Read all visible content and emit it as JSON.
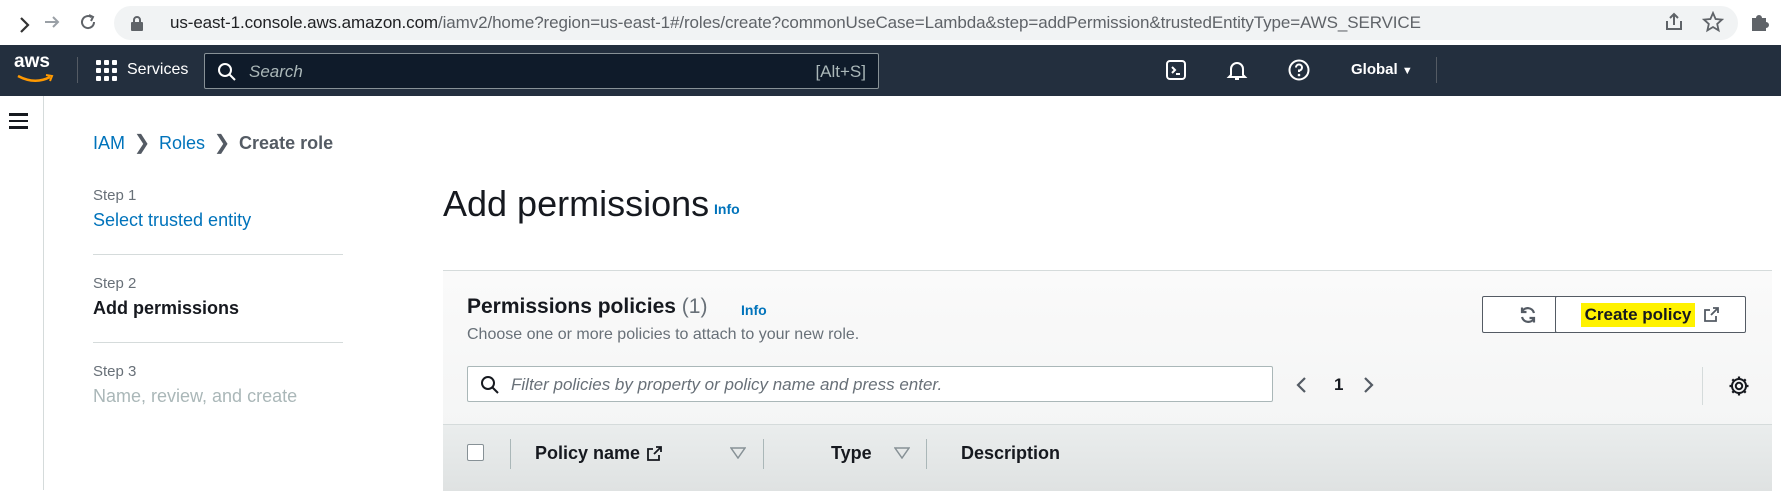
{
  "browser": {
    "url_host": "us-east-1.console.aws.amazon.com",
    "url_path": "/iamv2/home?region=us-east-1#/roles/create?commonUseCase=Lambda&step=addPermission&trustedEntityType=AWS_SERVICE"
  },
  "nav": {
    "logo": "aws",
    "services_label": "Services",
    "search_placeholder": "Search",
    "search_shortcut": "[Alt+S]",
    "region_label": "Global"
  },
  "breadcrumb": {
    "items": [
      "IAM",
      "Roles"
    ],
    "current": "Create role"
  },
  "steps": [
    {
      "num": "Step 1",
      "title": "Select trusted entity",
      "state": "link"
    },
    {
      "num": "Step 2",
      "title": "Add permissions",
      "state": "active"
    },
    {
      "num": "Step 3",
      "title": "Name, review, and create",
      "state": "disabled"
    }
  ],
  "page": {
    "title": "Add permissions",
    "info": "Info"
  },
  "policies": {
    "title": "Permissions policies",
    "count": "(1)",
    "info": "Info",
    "description": "Choose one or more policies to attach to your new role.",
    "create_policy_label": "Create policy",
    "filter_placeholder": "Filter policies by property or policy name and press enter.",
    "page_number": "1",
    "columns": [
      "Policy name",
      "Type",
      "Description"
    ]
  },
  "colors": {
    "nav_bg": "#232f3e",
    "link": "#0073bb",
    "highlight": "#fff200"
  }
}
